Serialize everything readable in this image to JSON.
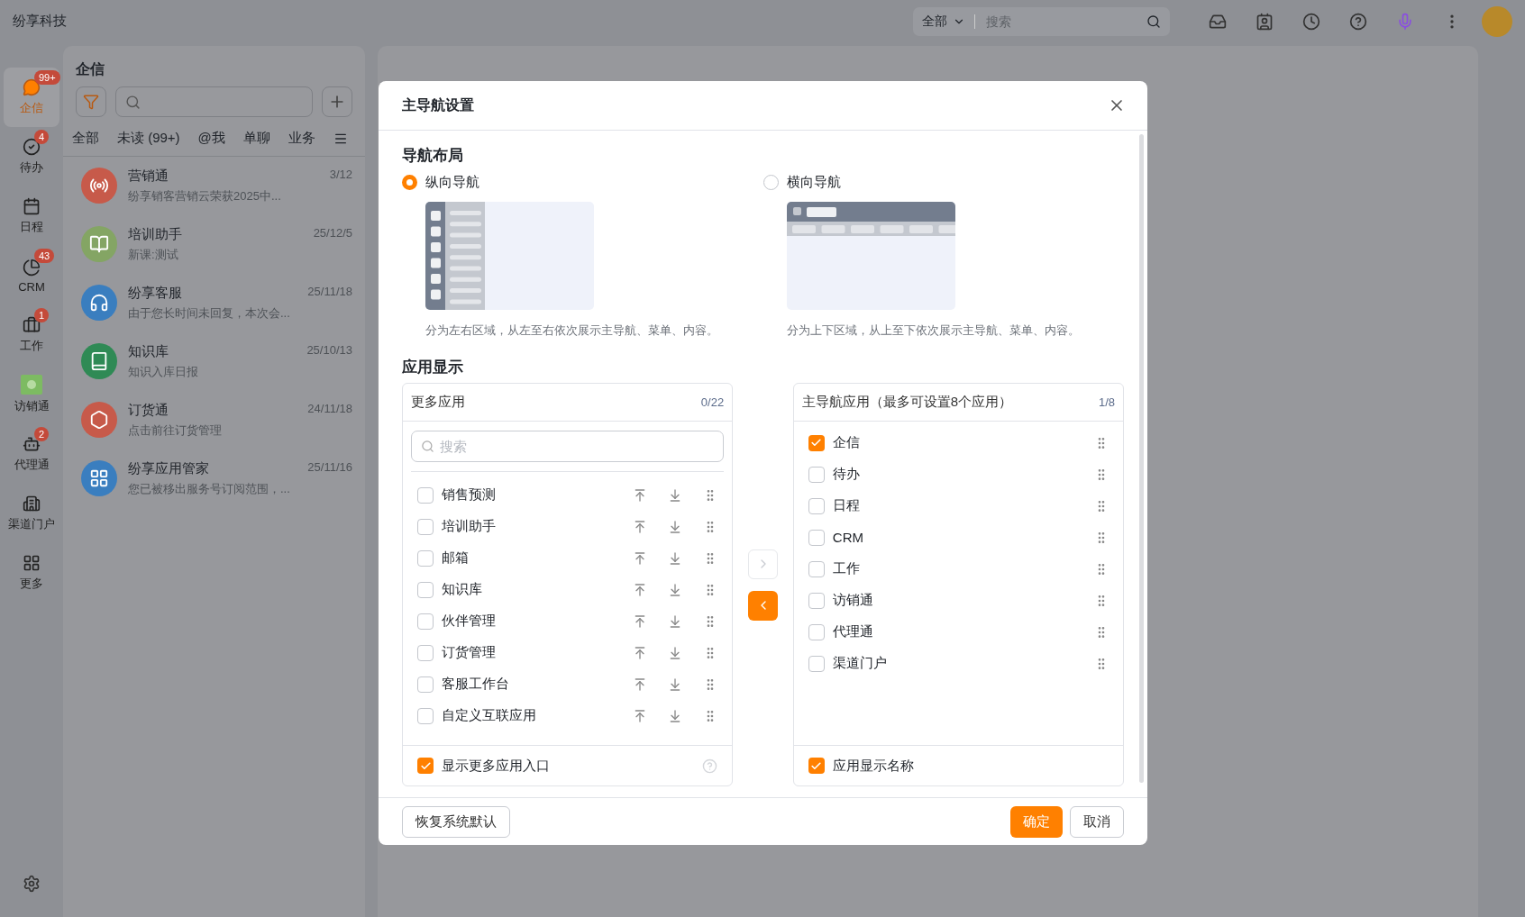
{
  "top_bar": {
    "company": "纷享科技",
    "search_scope": "全部",
    "search_placeholder": "搜索"
  },
  "nav": [
    {
      "label": "企信",
      "badge": "99+",
      "selected": true
    },
    {
      "label": "待办",
      "badge": "4",
      "selected": false
    },
    {
      "label": "日程",
      "selected": false
    },
    {
      "label": "CRM",
      "badge": "43",
      "selected": false
    },
    {
      "label": "工作",
      "badge": "1",
      "selected": false
    },
    {
      "label": "访销通",
      "selected": false
    },
    {
      "label": "代理通",
      "badge": "2",
      "selected": false
    },
    {
      "label": "渠道门户",
      "selected": false
    },
    {
      "label": "更多",
      "selected": false
    }
  ],
  "chat_panel": {
    "title": "企信",
    "filters": [
      "全部",
      "未读 (99+)",
      "@我",
      "单聊",
      "业务"
    ],
    "conversations": [
      {
        "name": "营销通",
        "preview": "纷享销客营销云荣获2025中...",
        "date": "3/12",
        "color": "#c75a4a"
      },
      {
        "name": "培训助手",
        "preview": "新课:测试",
        "date": "25/12/5",
        "color": "#84a564"
      },
      {
        "name": "纷享客服",
        "preview": "由于您长时间未回复，本次会...",
        "date": "25/11/18",
        "color": "#3a7ebf"
      },
      {
        "name": "知识库",
        "preview": "知识入库日报",
        "date": "25/10/13",
        "color": "#2f8a55"
      },
      {
        "name": "订货通",
        "preview": "点击前往订货管理",
        "date": "24/11/18",
        "color": "#c75a4a"
      },
      {
        "name": "纷享应用管家",
        "preview": "您已被移出服务号订阅范围，...",
        "date": "25/11/16",
        "color": "#3a7ebf"
      }
    ]
  },
  "modal": {
    "title": "主导航设置",
    "layout_section": {
      "title": "导航布局",
      "options": [
        {
          "kind": "vertical",
          "label": "纵向导航",
          "description": "分为左右区域，从左至右依次展示主导航、菜单、内容。",
          "selected": true
        },
        {
          "kind": "horizontal",
          "label": "横向导航",
          "description": "分为上下区域，从上至下依次展示主导航、菜单、内容。",
          "selected": false
        }
      ]
    },
    "apps_section": {
      "title": "应用显示",
      "more_apps": {
        "title": "更多应用",
        "count": "0/22",
        "search_placeholder": "搜索",
        "items": [
          {
            "label": "销售预测",
            "checked": false
          },
          {
            "label": "培训助手",
            "checked": false
          },
          {
            "label": "邮箱",
            "checked": false
          },
          {
            "label": "知识库",
            "checked": false
          },
          {
            "label": "伙伴管理",
            "checked": false
          },
          {
            "label": "订货管理",
            "checked": false
          },
          {
            "label": "客服工作台",
            "checked": false
          },
          {
            "label": "自定义互联应用",
            "checked": false
          }
        ],
        "footer": {
          "label": "显示更多应用入口",
          "checked": true
        }
      },
      "transfer": [
        {
          "kind": "right",
          "disabled": true
        },
        {
          "kind": "left",
          "disabled": false
        }
      ],
      "main_apps": {
        "title": "主导航应用（最多可设置8个应用）",
        "count": "1/8",
        "items": [
          {
            "label": "企信",
            "checked": true
          },
          {
            "label": "待办",
            "checked": false
          },
          {
            "label": "日程",
            "checked": false
          },
          {
            "label": "CRM",
            "checked": false
          },
          {
            "label": "工作",
            "checked": false
          },
          {
            "label": "访销通",
            "checked": false
          },
          {
            "label": "代理通",
            "checked": false
          },
          {
            "label": "渠道门户",
            "checked": false
          }
        ],
        "footer": {
          "label": "应用显示名称",
          "checked": true
        }
      }
    },
    "buttons": {
      "reset": "恢复系统默认",
      "ok": "确定",
      "cancel": "取消"
    }
  }
}
